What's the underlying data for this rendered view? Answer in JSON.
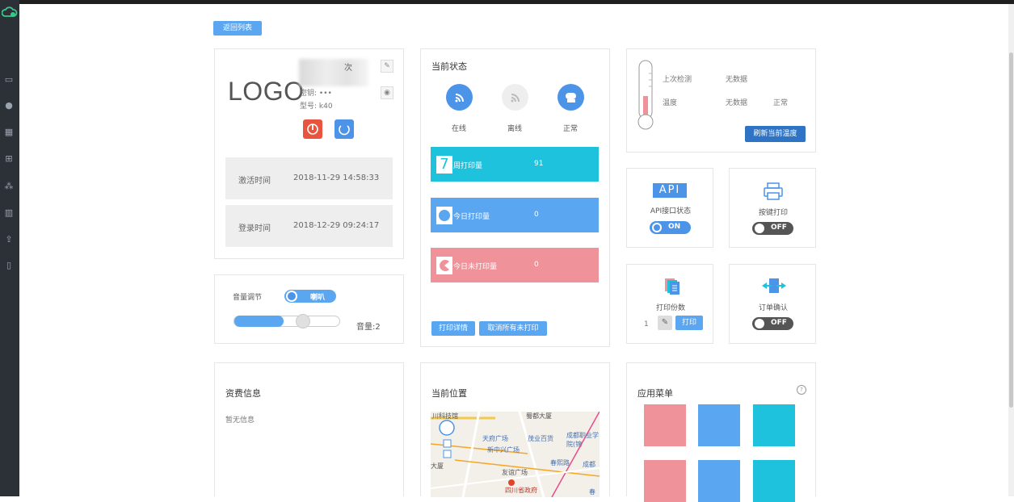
{
  "back_button": "返回列表",
  "device": {
    "logo": "LOGO",
    "name_suffix": "次",
    "password_label": "密钥: •••",
    "model_label": "型号: k40",
    "activation_label": "激活时间",
    "activation_time": "2018-11-29 14:58:33",
    "login_label": "登录时间",
    "login_time": "2018-12-29 09:24:17"
  },
  "volume": {
    "label": "音量调节",
    "speaker_toggle": "喇叭",
    "level_text": "音量:2",
    "level_fraction": 0.47
  },
  "status": {
    "title": "当前状态",
    "indicators": [
      {
        "label": "在线",
        "icon": "wifi-icon",
        "color": "#4b94e8"
      },
      {
        "label": "离线",
        "icon": "wifi-icon",
        "color": "#eeeeee"
      },
      {
        "label": "正常",
        "icon": "paper-roll-icon",
        "color": "#4b94e8"
      }
    ],
    "bars": [
      {
        "icon_text": "7",
        "label": "周打印量",
        "value": "91",
        "color": "#1ec2dc"
      },
      {
        "icon_text": "",
        "label": "今日打印量",
        "value": "0",
        "color": "#5aa6f0"
      },
      {
        "icon_text": "",
        "label": "今日未打印量",
        "value": "0",
        "color": "#f0929a"
      }
    ],
    "detail_button": "打印详情",
    "cancel_button": "取消所有未打印"
  },
  "temperature": {
    "last_check_label": "上次检测",
    "last_check_value": "无数据",
    "temp_label": "温度",
    "temp_value": "无数据",
    "temp_status": "正常",
    "refresh_button": "刷新当前温度"
  },
  "api": {
    "badge": "API",
    "label": "API接口状态",
    "toggle": "ON"
  },
  "key_print": {
    "label": "按键打印",
    "toggle": "OFF"
  },
  "print_copies": {
    "label": "打印份数",
    "value": "1",
    "print_button": "打印"
  },
  "order_confirm": {
    "label": "订单确认",
    "toggle": "OFF"
  },
  "billing": {
    "title": "资费信息",
    "text": "暂无信息"
  },
  "location": {
    "title": "当前位置",
    "map_labels": [
      "川科技馆",
      "蜀都大厦",
      "天府广场",
      "茂业百货",
      "成都职业学院(锦",
      "新中兴广场",
      "春熙路",
      "成都",
      "友谊广场",
      "四川省政府",
      "大厦",
      "春"
    ]
  },
  "app_menu": {
    "title": "应用菜单",
    "help": "?",
    "tiles": [
      "#f0929a",
      "#5aa6f0",
      "#1ec2dc",
      "#f0929a",
      "#5aa6f0",
      "#1ec2dc"
    ]
  }
}
